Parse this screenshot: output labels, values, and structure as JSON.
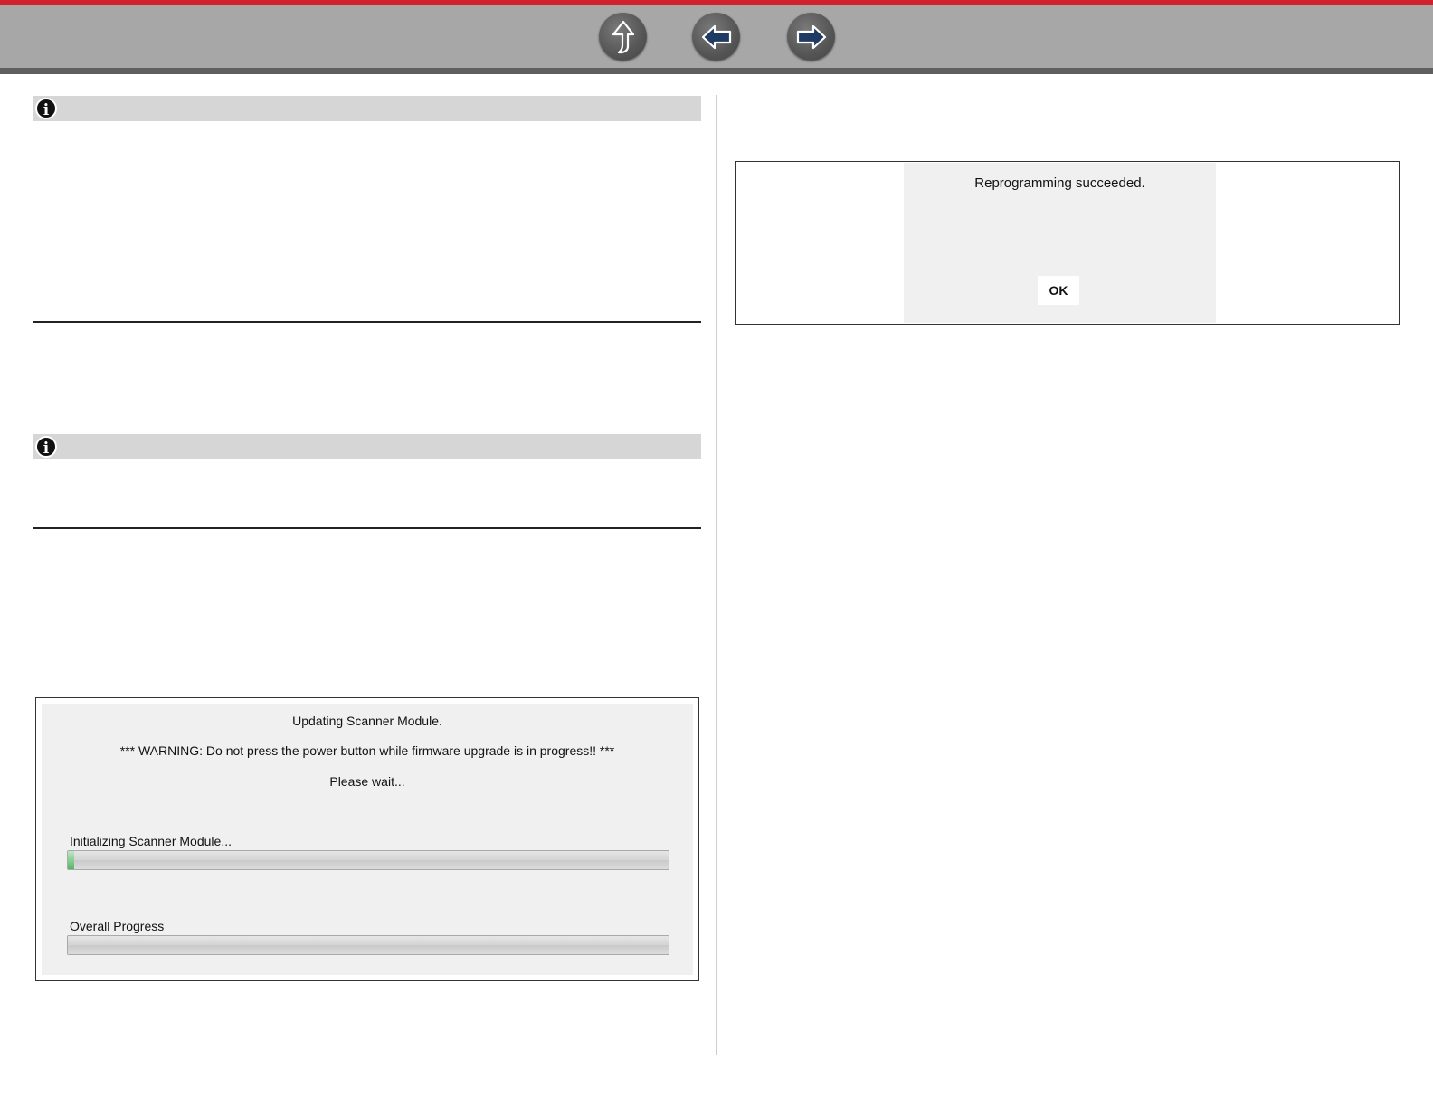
{
  "nav": {
    "up_icon": "up-arrow-icon",
    "back_icon": "left-arrow-icon",
    "forward_icon": "right-arrow-icon",
    "accent_color": "#d3202e",
    "bar_color": "#a7a7a7"
  },
  "notes": [
    {
      "icon": "info-icon",
      "glyph": "i"
    },
    {
      "icon": "info-icon",
      "glyph": "i"
    }
  ],
  "update_dialog": {
    "title": "Updating Scanner Module.",
    "warning": "*** WARNING: Do not press the power button while firmware upgrade is in progress!! ***",
    "wait": "Please wait...",
    "progress1_label": "Initializing Scanner Module...",
    "progress1_fraction": 0.01,
    "progress2_label": "Overall Progress",
    "progress2_fraction": 0.0
  },
  "success_dialog": {
    "message": "Reprogramming succeeded.",
    "ok_label": "OK"
  }
}
